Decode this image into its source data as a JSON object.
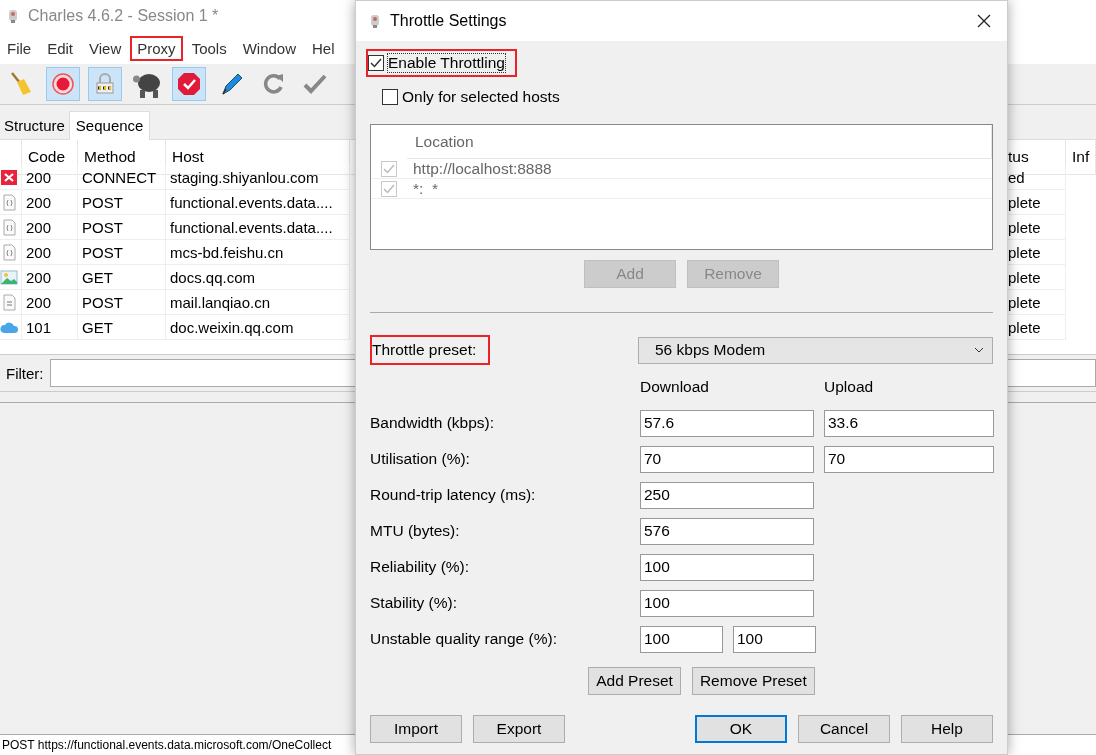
{
  "window": {
    "title": "Charles 4.6.2 - Session 1 *"
  },
  "menu": [
    {
      "label": "File",
      "highlighted": false
    },
    {
      "label": "Edit",
      "highlighted": false
    },
    {
      "label": "View",
      "highlighted": false
    },
    {
      "label": "Proxy",
      "highlighted": true
    },
    {
      "label": "Tools",
      "highlighted": false
    },
    {
      "label": "Window",
      "highlighted": false
    },
    {
      "label": "Hel",
      "highlighted": false
    }
  ],
  "toolbar": [
    {
      "kind": "broom",
      "on": false
    },
    {
      "kind": "record",
      "on": true
    },
    {
      "kind": "lock",
      "on": true
    },
    {
      "kind": "turtle",
      "on": false
    },
    {
      "kind": "stop",
      "on": true
    },
    {
      "kind": "pen",
      "on": false
    },
    {
      "kind": "refresh",
      "on": false
    },
    {
      "kind": "check",
      "on": false
    }
  ],
  "view_tabs": [
    {
      "label": "Structure",
      "selected": false
    },
    {
      "label": "Sequence",
      "selected": true
    }
  ],
  "table": {
    "columns": [
      "Code",
      "Method",
      "Host",
      "tus",
      "Inf"
    ],
    "rows": [
      {
        "kind": "error",
        "code": "200",
        "method": "CONNECT",
        "host": "staging.shiyanlou.com",
        "status": "ed"
      },
      {
        "kind": "json",
        "code": "200",
        "method": "POST",
        "host": "functional.events.data....",
        "status": "plete"
      },
      {
        "kind": "json",
        "code": "200",
        "method": "POST",
        "host": "functional.events.data....",
        "status": "plete"
      },
      {
        "kind": "json",
        "code": "200",
        "method": "POST",
        "host": "mcs-bd.feishu.cn",
        "status": "plete"
      },
      {
        "kind": "image",
        "code": "200",
        "method": "GET",
        "host": "docs.qq.com",
        "status": "plete"
      },
      {
        "kind": "script",
        "code": "200",
        "method": "POST",
        "host": "mail.lanqiao.cn",
        "status": "plete"
      },
      {
        "kind": "cloud",
        "code": "101",
        "method": "GET",
        "host": "doc.weixin.qq.com",
        "status": "plete"
      }
    ]
  },
  "filter": {
    "label": "Filter:"
  },
  "status_bar": "POST https://functional.events.data.microsoft.com/OneCollect",
  "dialog": {
    "title": "Throttle Settings",
    "enable": {
      "label": "Enable Throttling",
      "checked": true,
      "highlighted": true
    },
    "only_selected": {
      "label": "Only for selected hosts",
      "checked": false
    },
    "hosts": {
      "column": "Location",
      "rows": [
        {
          "location": "http://localhost:8888",
          "checked": true
        },
        {
          "location": "*:  *",
          "checked": true
        }
      ]
    },
    "host_buttons": [
      {
        "label": "Add",
        "disabled": true
      },
      {
        "label": "Remove",
        "disabled": true
      }
    ],
    "preset": {
      "label": "Throttle preset:",
      "highlighted": true,
      "value": "56 kbps Modem"
    },
    "columns": [
      "Download",
      "Upload"
    ],
    "fields": [
      {
        "kind": "pair",
        "label": "Bandwidth (kbps):",
        "values": [
          "57.6",
          "33.6"
        ]
      },
      {
        "kind": "pair",
        "label": "Utilisation (%):",
        "values": [
          "70",
          "70"
        ]
      },
      {
        "kind": "single",
        "label": "Round-trip latency (ms):",
        "values": [
          "250"
        ]
      },
      {
        "kind": "single",
        "label": "MTU (bytes):",
        "values": [
          "576"
        ]
      },
      {
        "kind": "single",
        "label": "Reliability (%):",
        "values": [
          "100"
        ]
      },
      {
        "kind": "single",
        "label": "Stability (%):",
        "values": [
          "100"
        ]
      },
      {
        "kind": "range",
        "label": "Unstable quality range (%):",
        "values": [
          "100",
          "100"
        ]
      }
    ],
    "preset_buttons": [
      {
        "label": "Add Preset"
      },
      {
        "label": "Remove Preset"
      }
    ],
    "buttons": [
      {
        "label": "Import",
        "default": false
      },
      {
        "label": "Export",
        "default": false
      },
      {
        "label": "OK",
        "default": true
      },
      {
        "label": "Cancel",
        "default": false
      },
      {
        "label": "Help",
        "default": false
      }
    ]
  }
}
